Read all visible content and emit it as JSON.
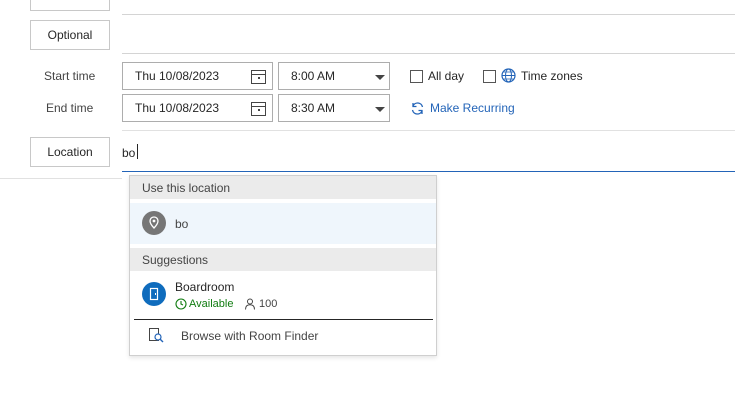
{
  "form": {
    "optional_label": "Optional",
    "start_time_label": "Start time",
    "end_time_label": "End time",
    "start_date": "Thu 10/08/2023",
    "start_time": "8:00 AM",
    "end_date": "Thu 10/08/2023",
    "end_time": "8:30 AM",
    "all_day_label": "All day",
    "time_zones_label": "Time zones",
    "make_recurring_label": "Make Recurring",
    "location_label": "Location",
    "location_value": "bo"
  },
  "dropdown": {
    "use_location_header": "Use this location",
    "typed_location": "bo",
    "suggestions_header": "Suggestions",
    "room_name": "Boardroom",
    "room_status": "Available",
    "room_capacity": "100",
    "browse_label": "Browse with Room Finder"
  },
  "colors": {
    "accent": "#2364b8",
    "available": "#107c10",
    "room_icon_bg": "#0f6cbd"
  }
}
